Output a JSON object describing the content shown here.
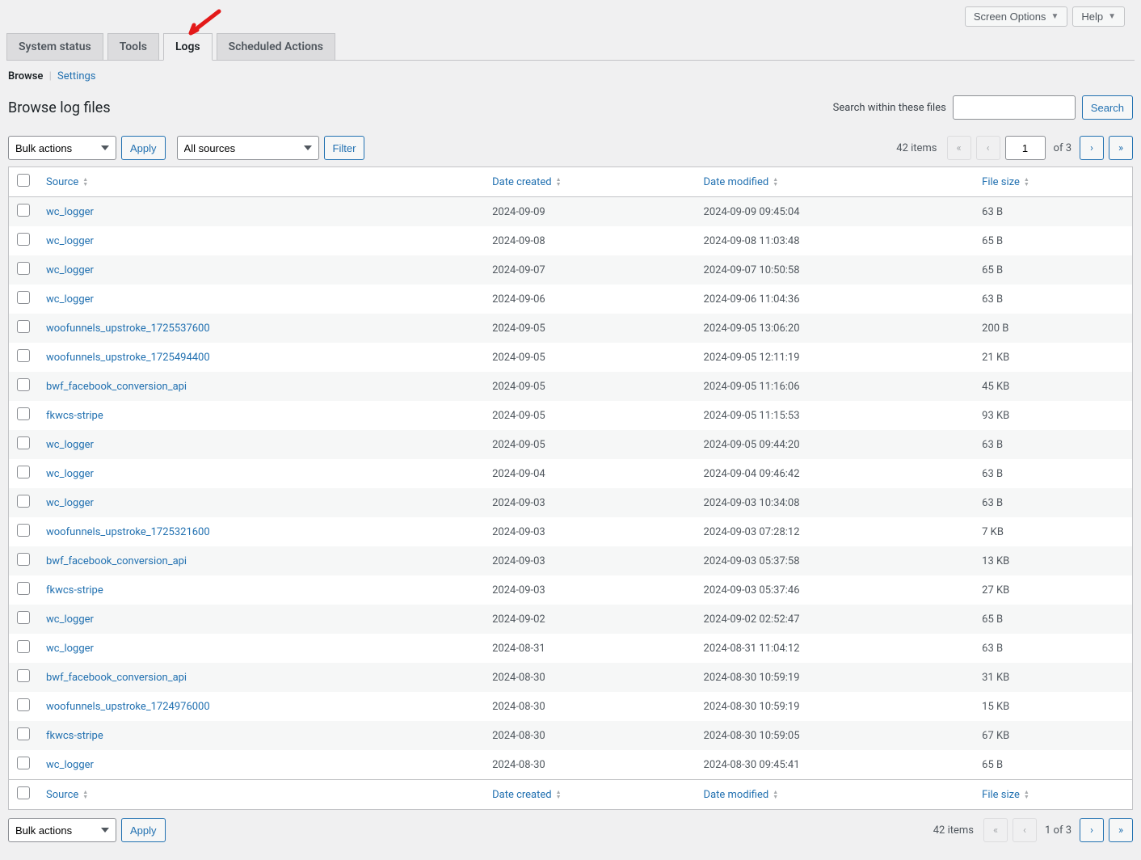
{
  "topnav": {
    "screen_options": "Screen Options",
    "help": "Help"
  },
  "tabs": {
    "system_status": "System status",
    "tools": "Tools",
    "logs": "Logs",
    "scheduled_actions": "Scheduled Actions"
  },
  "subnav": {
    "browse": "Browse",
    "settings": "Settings"
  },
  "page": {
    "title": "Browse log files",
    "search_label": "Search within these files",
    "search_button": "Search"
  },
  "toolbar": {
    "bulk_actions": "Bulk actions",
    "apply": "Apply",
    "all_sources": "All sources",
    "filter": "Filter"
  },
  "pagination": {
    "count_top": "42 items",
    "count_bottom": "42 items",
    "of_total": "of 3",
    "current": "1",
    "bottom_text": "1 of 3"
  },
  "columns": {
    "source": "Source",
    "date_created": "Date created",
    "date_modified": "Date modified",
    "file_size": "File size"
  },
  "rows": [
    {
      "source": "wc_logger",
      "created": "2024-09-09",
      "modified": "2024-09-09 09:45:04",
      "size": "63 B"
    },
    {
      "source": "wc_logger",
      "created": "2024-09-08",
      "modified": "2024-09-08 11:03:48",
      "size": "65 B"
    },
    {
      "source": "wc_logger",
      "created": "2024-09-07",
      "modified": "2024-09-07 10:50:58",
      "size": "65 B"
    },
    {
      "source": "wc_logger",
      "created": "2024-09-06",
      "modified": "2024-09-06 11:04:36",
      "size": "63 B"
    },
    {
      "source": "woofunnels_upstroke_1725537600",
      "created": "2024-09-05",
      "modified": "2024-09-05 13:06:20",
      "size": "200 B"
    },
    {
      "source": "woofunnels_upstroke_1725494400",
      "created": "2024-09-05",
      "modified": "2024-09-05 12:11:19",
      "size": "21 KB"
    },
    {
      "source": "bwf_facebook_conversion_api",
      "created": "2024-09-05",
      "modified": "2024-09-05 11:16:06",
      "size": "45 KB"
    },
    {
      "source": "fkwcs-stripe",
      "created": "2024-09-05",
      "modified": "2024-09-05 11:15:53",
      "size": "93 KB"
    },
    {
      "source": "wc_logger",
      "created": "2024-09-05",
      "modified": "2024-09-05 09:44:20",
      "size": "63 B"
    },
    {
      "source": "wc_logger",
      "created": "2024-09-04",
      "modified": "2024-09-04 09:46:42",
      "size": "63 B"
    },
    {
      "source": "wc_logger",
      "created": "2024-09-03",
      "modified": "2024-09-03 10:34:08",
      "size": "63 B"
    },
    {
      "source": "woofunnels_upstroke_1725321600",
      "created": "2024-09-03",
      "modified": "2024-09-03 07:28:12",
      "size": "7 KB"
    },
    {
      "source": "bwf_facebook_conversion_api",
      "created": "2024-09-03",
      "modified": "2024-09-03 05:37:58",
      "size": "13 KB"
    },
    {
      "source": "fkwcs-stripe",
      "created": "2024-09-03",
      "modified": "2024-09-03 05:37:46",
      "size": "27 KB"
    },
    {
      "source": "wc_logger",
      "created": "2024-09-02",
      "modified": "2024-09-02 02:52:47",
      "size": "65 B"
    },
    {
      "source": "wc_logger",
      "created": "2024-08-31",
      "modified": "2024-08-31 11:04:12",
      "size": "63 B"
    },
    {
      "source": "bwf_facebook_conversion_api",
      "created": "2024-08-30",
      "modified": "2024-08-30 10:59:19",
      "size": "31 KB"
    },
    {
      "source": "woofunnels_upstroke_1724976000",
      "created": "2024-08-30",
      "modified": "2024-08-30 10:59:19",
      "size": "15 KB"
    },
    {
      "source": "fkwcs-stripe",
      "created": "2024-08-30",
      "modified": "2024-08-30 10:59:05",
      "size": "67 KB"
    },
    {
      "source": "wc_logger",
      "created": "2024-08-30",
      "modified": "2024-08-30 09:45:41",
      "size": "65 B"
    }
  ]
}
